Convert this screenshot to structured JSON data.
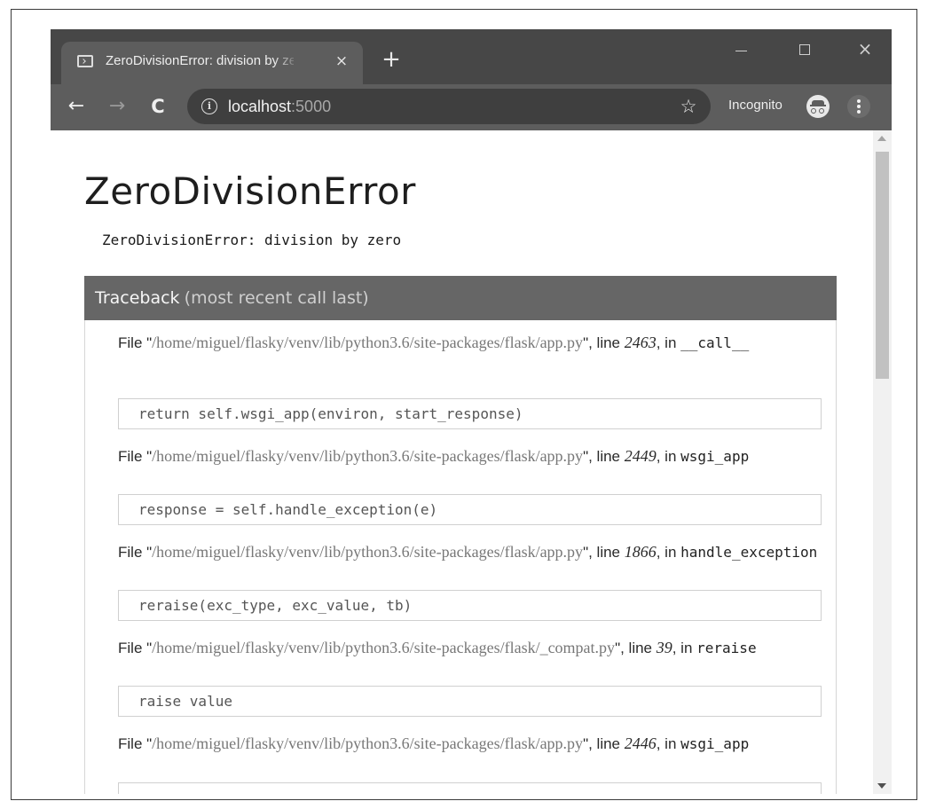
{
  "browser": {
    "tab_title": "ZeroDivisionError: division by zero",
    "tab_close_glyph": "×",
    "new_tab_glyph": "+",
    "window_close_glyph": "×",
    "back_glyph": "←",
    "forward_glyph": "→",
    "reload_glyph": "C",
    "info_glyph": "i",
    "url_host": "localhost",
    "url_port": ":5000",
    "star_glyph": "☆",
    "incognito_label": "Incognito",
    "icons": {
      "favicon": "terminal-icon",
      "info": "info-icon",
      "bookmark": "star-icon",
      "incognito": "incognito-icon",
      "menu": "kebab-menu-icon"
    }
  },
  "page": {
    "title": "ZeroDivisionError",
    "error_message": "ZeroDivisionError: division by zero",
    "traceback_title": "Traceback",
    "traceback_subtitle": "(most recent call last)",
    "frames": [
      {
        "file_label": "File \"",
        "filename": "/home/miguel/flasky/venv/lib/python3.6/site-packages/flask/app.py",
        "line_label": "\", line ",
        "lineno": "2463",
        "in_label": ", in ",
        "function": "__call__",
        "code": "return self.wsgi_app(environ, start_response)"
      },
      {
        "file_label": "File \"",
        "filename": "/home/miguel/flasky/venv/lib/python3.6/site-packages/flask/app.py",
        "line_label": "\", line ",
        "lineno": "2449",
        "in_label": ", in ",
        "function": "wsgi_app",
        "code": "response = self.handle_exception(e)"
      },
      {
        "file_label": "File \"",
        "filename": "/home/miguel/flasky/venv/lib/python3.6/site-packages/flask/app.py",
        "line_label": "\", line ",
        "lineno": "1866",
        "in_label": ", in ",
        "function": "handle_exception",
        "code": "reraise(exc_type, exc_value, tb)"
      },
      {
        "file_label": "File \"",
        "filename": "/home/miguel/flasky/venv/lib/python3.6/site-packages/flask/_compat.py",
        "line_label": "\", line ",
        "lineno": "39",
        "in_label": ", in ",
        "function": "reraise",
        "code": "raise value"
      },
      {
        "file_label": "File \"",
        "filename": "/home/miguel/flasky/venv/lib/python3.6/site-packages/flask/app.py",
        "line_label": "\", line ",
        "lineno": "2446",
        "in_label": ", in ",
        "function": "wsgi_app",
        "code": ""
      }
    ]
  }
}
